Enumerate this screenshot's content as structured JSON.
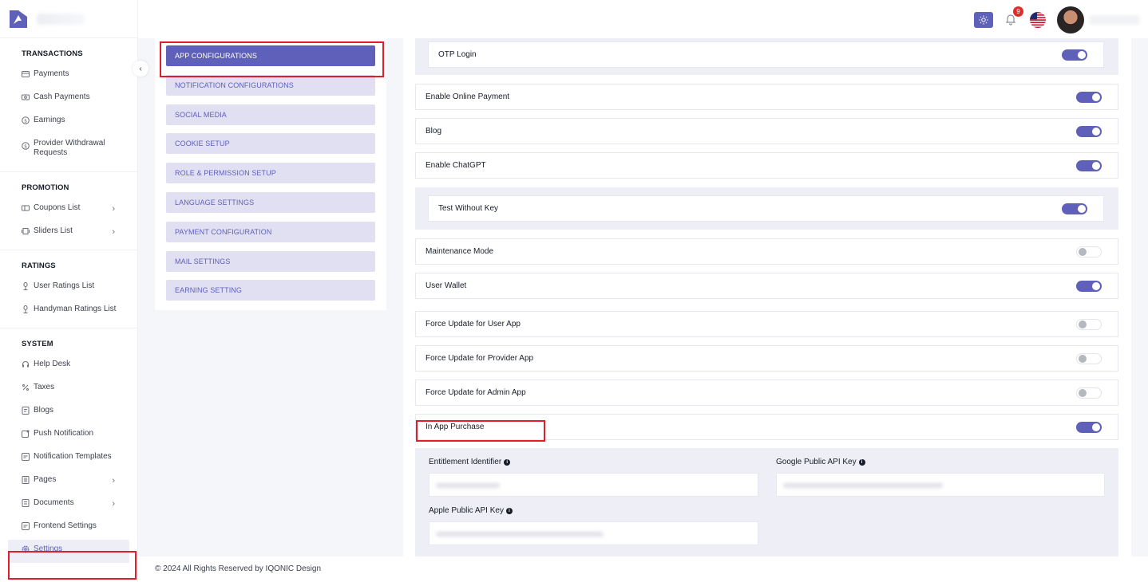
{
  "colors": {
    "accent": "#5f60b9",
    "accent_light": "#e1e0f3",
    "highlight": "#e21d2b",
    "badge": "#e32b2b"
  },
  "sidebar": {
    "sections": [
      {
        "title": "TRANSACTIONS",
        "items": [
          {
            "label": "Payments",
            "icon": "credit-card-icon"
          },
          {
            "label": "Cash Payments",
            "icon": "cash-icon"
          },
          {
            "label": "Earnings",
            "icon": "dollar-circle-icon"
          },
          {
            "label": "Provider Withdrawal Requests",
            "icon": "dollar-circle-icon"
          }
        ]
      },
      {
        "title": "PROMOTION",
        "items": [
          {
            "label": "Coupons List",
            "icon": "coupon-icon"
          },
          {
            "label": "Sliders List",
            "icon": "slider-icon"
          }
        ]
      },
      {
        "title": "RATINGS",
        "items": [
          {
            "label": "User Ratings List",
            "icon": "rating-icon"
          },
          {
            "label": "Handyman Ratings List",
            "icon": "rating-icon"
          }
        ]
      },
      {
        "title": "SYSTEM",
        "items": [
          {
            "label": "Help Desk",
            "icon": "headset-icon"
          },
          {
            "label": "Taxes",
            "icon": "percent-icon"
          },
          {
            "label": "Blogs",
            "icon": "blog-icon"
          },
          {
            "label": "Push Notification",
            "icon": "push-notification-icon"
          },
          {
            "label": "Notification Templates",
            "icon": "template-icon"
          },
          {
            "label": "Pages",
            "icon": "pages-icon"
          },
          {
            "label": "Documents",
            "icon": "document-icon"
          },
          {
            "label": "Frontend Settings",
            "icon": "frontend-icon"
          },
          {
            "label": "Settings",
            "icon": "gear-icon"
          }
        ]
      }
    ]
  },
  "header": {
    "notification_count": "9"
  },
  "settings_menu": [
    "APP CONFIGURATIONS",
    "NOTIFICATION CONFIGURATIONS",
    "SOCIAL MEDIA",
    "COOKIE SETUP",
    "ROLE & PERMISSION SETUP",
    "LANGUAGE SETTINGS",
    "PAYMENT CONFIGURATION",
    "MAIL SETTINGS",
    "EARNING SETTING"
  ],
  "config_rows": {
    "otp_login": {
      "label": "OTP Login",
      "enabled": true
    },
    "online_payment": {
      "label": "Enable Online Payment",
      "enabled": true
    },
    "blog": {
      "label": "Blog",
      "enabled": true
    },
    "chatgpt": {
      "label": "Enable ChatGPT",
      "enabled": true
    },
    "test_without_key": {
      "label": "Test Without Key",
      "enabled": true
    },
    "maintenance": {
      "label": "Maintenance Mode",
      "enabled": false
    },
    "user_wallet": {
      "label": "User Wallet",
      "enabled": true
    },
    "force_user": {
      "label": "Force Update for User App",
      "enabled": false
    },
    "force_provider": {
      "label": "Force Update for Provider App",
      "enabled": false
    },
    "force_admin": {
      "label": "Force Update for Admin App",
      "enabled": false
    },
    "in_app_purchase": {
      "label": "In App Purchase",
      "enabled": true
    }
  },
  "iap_fields": {
    "entitlement_label": "Entitlement Identifier",
    "google_key_label": "Google Public API Key",
    "apple_key_label": "Apple Public API Key"
  },
  "footer": {
    "text": "© 2024 All Rights Reserved by IQONIC Design"
  }
}
